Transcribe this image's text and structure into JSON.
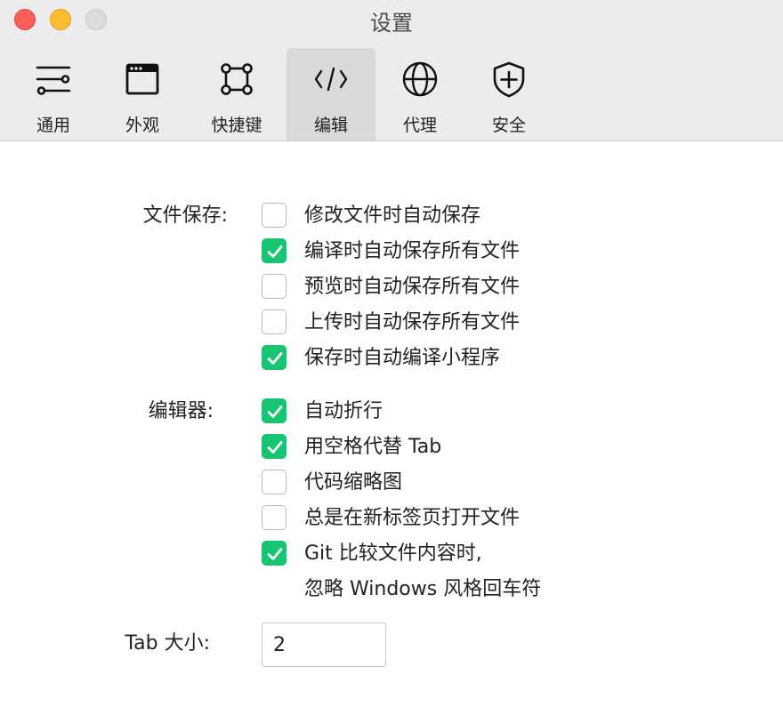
{
  "window": {
    "title": "设置"
  },
  "toolbar": {
    "tabs": [
      {
        "id": "general",
        "label": "通用",
        "icon": "sliders-icon",
        "active": false
      },
      {
        "id": "appearance",
        "label": "外观",
        "icon": "window-icon",
        "active": false
      },
      {
        "id": "shortcuts",
        "label": "快捷键",
        "icon": "command-key-icon",
        "active": false
      },
      {
        "id": "editor",
        "label": "编辑",
        "icon": "code-icon",
        "active": true
      },
      {
        "id": "proxy",
        "label": "代理",
        "icon": "globe-icon",
        "active": false
      },
      {
        "id": "security",
        "label": "安全",
        "icon": "shield-plus-icon",
        "active": false
      }
    ]
  },
  "file_save": {
    "label": "文件保存:",
    "options": [
      {
        "label": "修改文件时自动保存",
        "checked": false
      },
      {
        "label": "编译时自动保存所有文件",
        "checked": true
      },
      {
        "label": "预览时自动保存所有文件",
        "checked": false
      },
      {
        "label": "上传时自动保存所有文件",
        "checked": false
      },
      {
        "label": "保存时自动编译小程序",
        "checked": true
      }
    ]
  },
  "editor": {
    "label": "编辑器:",
    "options": [
      {
        "label": "自动折行",
        "checked": true
      },
      {
        "label": "用空格代替 Tab",
        "checked": true
      },
      {
        "label": "代码缩略图",
        "checked": false
      },
      {
        "label": "总是在新标签页打开文件",
        "checked": false
      },
      {
        "label": "Git 比较文件内容时,",
        "label2": "忽略 Windows 风格回车符",
        "checked": true
      }
    ]
  },
  "tab_size": {
    "label": "Tab 大小:",
    "value": "2"
  },
  "colors": {
    "check_green": "#17c471",
    "active_tab_bg": "#d9d9d9"
  }
}
